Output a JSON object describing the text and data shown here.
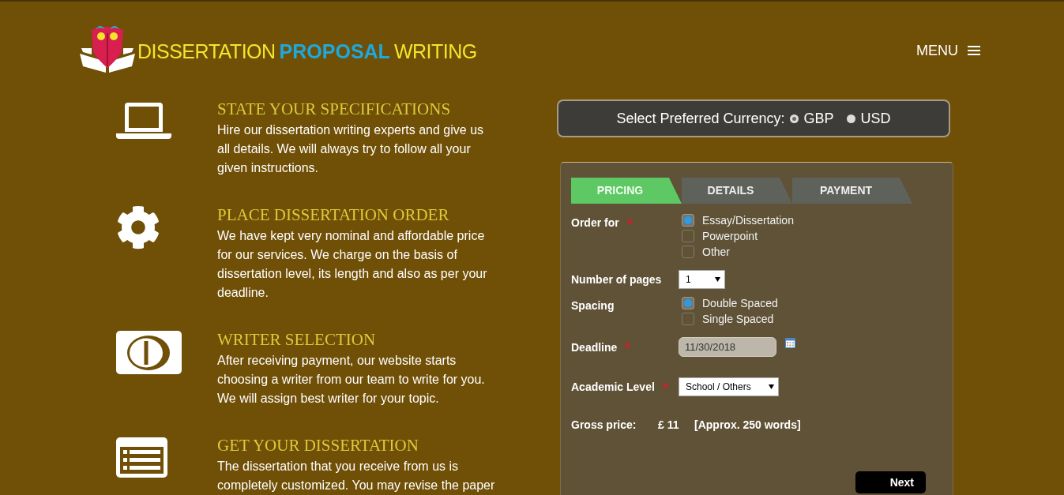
{
  "logo": {
    "words": [
      {
        "text": "DISSERTATION",
        "kind": "light"
      },
      {
        "text": "PROPOSAL",
        "kind": "bold"
      },
      {
        "text": "WRITING",
        "kind": "light"
      }
    ]
  },
  "menu": {
    "label": "MENU"
  },
  "steps": [
    {
      "title": "STATE YOUR SPECIFICATIONS",
      "text": "Hire our dissertation writing experts and give us all details. We will always try to follow all your given instructions."
    },
    {
      "title": "PLACE DISSERTATION ORDER",
      "text": "We have kept very nominal and affordable price for our services. We charge on the basis of dissertation level, its length and also as per your deadline."
    },
    {
      "title": "WRITER SELECTION",
      "text": "After receiving payment, our website starts choosing a writer from our team to write for you. We will assign best writer for your topic."
    },
    {
      "title": "GET YOUR DISSERTATION",
      "text": "The dissertation that you receive from us is completely customized. You may revise the paper"
    }
  ],
  "currency": {
    "label": "Select Preferred Currency:",
    "options": [
      {
        "label": "GBP",
        "selected": true
      },
      {
        "label": "USD",
        "selected": false
      }
    ]
  },
  "order_form": {
    "tabs": [
      {
        "label": "PRICING",
        "selected": true
      },
      {
        "label": "DETAILS",
        "selected": false
      },
      {
        "label": "PAYMENT",
        "selected": false
      }
    ],
    "fields": [
      {
        "kind": "choice",
        "label": "Order for",
        "required": true,
        "options": [
          {
            "label": "Essay/Dissertation",
            "selected": true
          },
          {
            "label": "Powerpoint",
            "selected": false
          },
          {
            "label": "Other",
            "selected": false
          }
        ]
      },
      {
        "kind": "select",
        "label": "Number of pages",
        "required": false,
        "value": "1"
      },
      {
        "kind": "choice",
        "label": "Spacing",
        "required": false,
        "options": [
          {
            "label": "Double Spaced",
            "selected": true
          },
          {
            "label": "Single Spaced",
            "selected": false
          }
        ]
      },
      {
        "kind": "date",
        "label": "Deadline",
        "required": true,
        "value": "11/30/2018"
      },
      {
        "kind": "select",
        "label": "Academic Level",
        "required": true,
        "value": "School / Others"
      }
    ],
    "gross_price": {
      "label": "Gross price:",
      "amount": "£ 11",
      "note": "[Approx. 250 words]"
    },
    "next_button": {
      "label": "Next"
    }
  }
}
